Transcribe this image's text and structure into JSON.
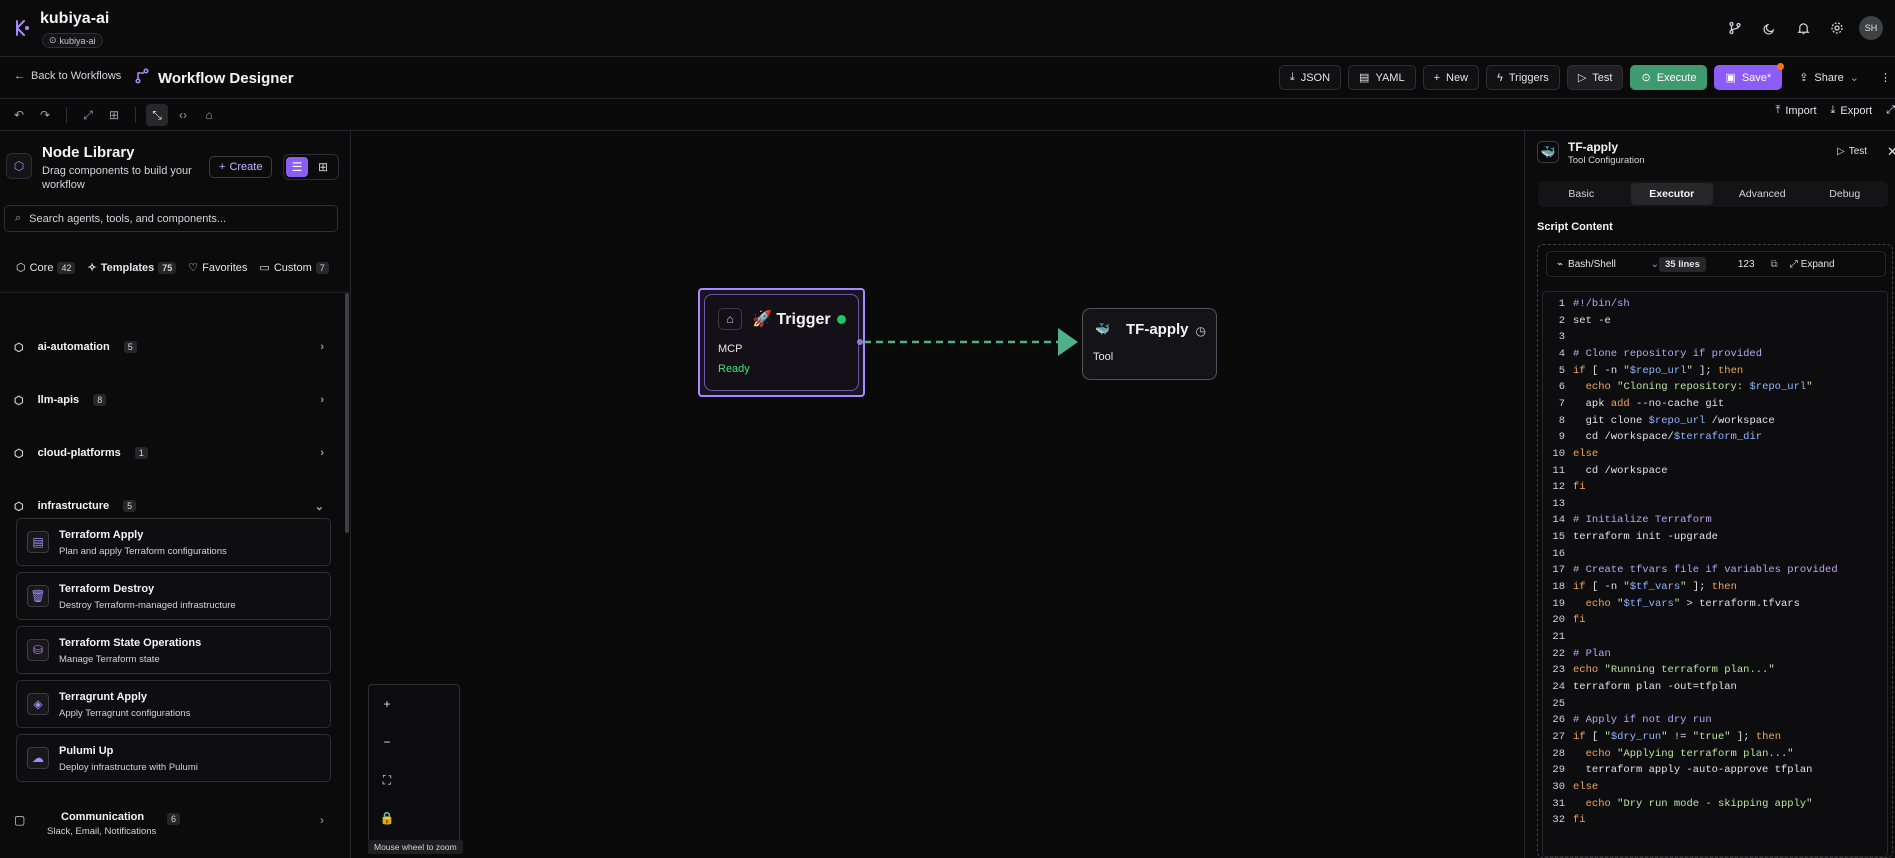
{
  "app": {
    "name": "kubiya-ai",
    "org": "kubiya-ai",
    "avatar": "SH"
  },
  "nav": {
    "back_label": "Back to Workflows",
    "title": "Workflow Designer",
    "actions": {
      "json": "JSON",
      "yaml": "YAML",
      "new": "New",
      "triggers": "Triggers",
      "test": "Test",
      "execute": "Execute",
      "save": "Save*",
      "share": "Share"
    }
  },
  "toolbar": {
    "import": "Import",
    "export": "Export"
  },
  "library": {
    "title": "Node Library",
    "subtitle": "Drag components to build your workflow",
    "create_label": "Create",
    "search_placeholder": "Search agents, tools, and components...",
    "tabs": [
      {
        "label": "Core",
        "count": "42"
      },
      {
        "label": "Templates",
        "count": "75"
      },
      {
        "label": "Favorites",
        "count": ""
      },
      {
        "label": "Custom",
        "count": "7"
      }
    ],
    "groups": [
      {
        "label": "ai-automation",
        "count": "5",
        "expanded": false
      },
      {
        "label": "llm-apis",
        "count": "8",
        "expanded": false
      },
      {
        "label": "cloud-platforms",
        "count": "1",
        "expanded": false
      },
      {
        "label": "infrastructure",
        "count": "5",
        "expanded": true
      }
    ],
    "infrastructure_items": [
      {
        "name": "Terraform Apply",
        "desc": "Plan and apply Terraform configurations"
      },
      {
        "name": "Terraform Destroy",
        "desc": "Destroy Terraform-managed infrastructure"
      },
      {
        "name": "Terraform State Operations",
        "desc": "Manage Terraform state"
      },
      {
        "name": "Terragrunt Apply",
        "desc": "Apply Terragrunt configurations"
      },
      {
        "name": "Pulumi Up",
        "desc": "Deploy infrastructure with Pulumi"
      }
    ],
    "communication": {
      "label": "Communication",
      "count": "6",
      "desc": "Slack, Email, Notifications"
    }
  },
  "canvas": {
    "trigger": {
      "emoji": "🚀",
      "title": "Trigger",
      "kind": "MCP",
      "status": "Ready",
      "status_color": "#4ade80"
    },
    "tool": {
      "title": "TF-apply",
      "kind": "Tool"
    },
    "zoom_hint": "Mouse wheel to zoom"
  },
  "panel": {
    "title": "TF-apply",
    "subtitle": "Tool Configuration",
    "test_label": "Test",
    "tabs": [
      "Basic",
      "Executor",
      "Advanced",
      "Debug"
    ],
    "active_tab": "Executor",
    "script_label": "Script Content",
    "language": "Bash/Shell",
    "lines_label": "35 lines",
    "numbers_label": "123",
    "expand_label": "Expand",
    "code": [
      "#!/bin/sh",
      "set -e",
      "",
      "# Clone repository if provided",
      "if [ -n \"$repo_url\" ]; then",
      "  echo \"Cloning repository: $repo_url\"",
      "  apk add --no-cache git",
      "  git clone $repo_url /workspace",
      "  cd /workspace/$terraform_dir",
      "else",
      "  cd /workspace",
      "fi",
      "",
      "# Initialize Terraform",
      "terraform init -upgrade",
      "",
      "# Create tfvars file if variables provided",
      "if [ -n \"$tf_vars\" ]; then",
      "  echo \"$tf_vars\" > terraform.tfvars",
      "fi",
      "",
      "# Plan",
      "echo \"Running terraform plan...\"",
      "terraform plan -out=tfplan",
      "",
      "# Apply if not dry run",
      "if [ \"$dry_run\" != \"true\" ]; then",
      "  echo \"Applying terraform plan...\"",
      "  terraform apply -auto-approve tfplan",
      "else",
      "  echo \"Dry run mode - skipping apply\"",
      "fi"
    ]
  },
  "colors": {
    "accent": "#8b5cf6",
    "execute": "#3f9a6e",
    "edge": "#4fb08a",
    "ready": "#22c55e"
  }
}
